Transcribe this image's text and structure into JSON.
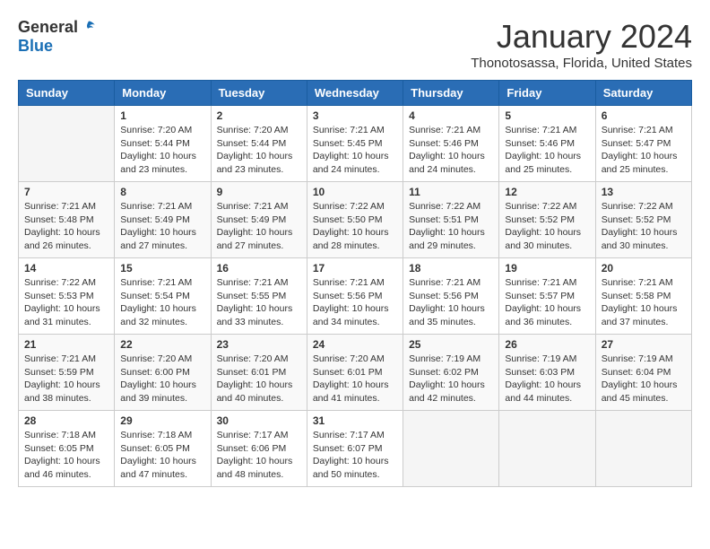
{
  "header": {
    "logo_general": "General",
    "logo_blue": "Blue",
    "title": "January 2024",
    "subtitle": "Thonotosassa, Florida, United States"
  },
  "days_of_week": [
    "Sunday",
    "Monday",
    "Tuesday",
    "Wednesday",
    "Thursday",
    "Friday",
    "Saturday"
  ],
  "weeks": [
    [
      {
        "day": "",
        "info": ""
      },
      {
        "day": "1",
        "info": "Sunrise: 7:20 AM\nSunset: 5:44 PM\nDaylight: 10 hours\nand 23 minutes."
      },
      {
        "day": "2",
        "info": "Sunrise: 7:20 AM\nSunset: 5:44 PM\nDaylight: 10 hours\nand 23 minutes."
      },
      {
        "day": "3",
        "info": "Sunrise: 7:21 AM\nSunset: 5:45 PM\nDaylight: 10 hours\nand 24 minutes."
      },
      {
        "day": "4",
        "info": "Sunrise: 7:21 AM\nSunset: 5:46 PM\nDaylight: 10 hours\nand 24 minutes."
      },
      {
        "day": "5",
        "info": "Sunrise: 7:21 AM\nSunset: 5:46 PM\nDaylight: 10 hours\nand 25 minutes."
      },
      {
        "day": "6",
        "info": "Sunrise: 7:21 AM\nSunset: 5:47 PM\nDaylight: 10 hours\nand 25 minutes."
      }
    ],
    [
      {
        "day": "7",
        "info": "Sunrise: 7:21 AM\nSunset: 5:48 PM\nDaylight: 10 hours\nand 26 minutes."
      },
      {
        "day": "8",
        "info": "Sunrise: 7:21 AM\nSunset: 5:49 PM\nDaylight: 10 hours\nand 27 minutes."
      },
      {
        "day": "9",
        "info": "Sunrise: 7:21 AM\nSunset: 5:49 PM\nDaylight: 10 hours\nand 27 minutes."
      },
      {
        "day": "10",
        "info": "Sunrise: 7:22 AM\nSunset: 5:50 PM\nDaylight: 10 hours\nand 28 minutes."
      },
      {
        "day": "11",
        "info": "Sunrise: 7:22 AM\nSunset: 5:51 PM\nDaylight: 10 hours\nand 29 minutes."
      },
      {
        "day": "12",
        "info": "Sunrise: 7:22 AM\nSunset: 5:52 PM\nDaylight: 10 hours\nand 30 minutes."
      },
      {
        "day": "13",
        "info": "Sunrise: 7:22 AM\nSunset: 5:52 PM\nDaylight: 10 hours\nand 30 minutes."
      }
    ],
    [
      {
        "day": "14",
        "info": "Sunrise: 7:22 AM\nSunset: 5:53 PM\nDaylight: 10 hours\nand 31 minutes."
      },
      {
        "day": "15",
        "info": "Sunrise: 7:21 AM\nSunset: 5:54 PM\nDaylight: 10 hours\nand 32 minutes."
      },
      {
        "day": "16",
        "info": "Sunrise: 7:21 AM\nSunset: 5:55 PM\nDaylight: 10 hours\nand 33 minutes."
      },
      {
        "day": "17",
        "info": "Sunrise: 7:21 AM\nSunset: 5:56 PM\nDaylight: 10 hours\nand 34 minutes."
      },
      {
        "day": "18",
        "info": "Sunrise: 7:21 AM\nSunset: 5:56 PM\nDaylight: 10 hours\nand 35 minutes."
      },
      {
        "day": "19",
        "info": "Sunrise: 7:21 AM\nSunset: 5:57 PM\nDaylight: 10 hours\nand 36 minutes."
      },
      {
        "day": "20",
        "info": "Sunrise: 7:21 AM\nSunset: 5:58 PM\nDaylight: 10 hours\nand 37 minutes."
      }
    ],
    [
      {
        "day": "21",
        "info": "Sunrise: 7:21 AM\nSunset: 5:59 PM\nDaylight: 10 hours\nand 38 minutes."
      },
      {
        "day": "22",
        "info": "Sunrise: 7:20 AM\nSunset: 6:00 PM\nDaylight: 10 hours\nand 39 minutes."
      },
      {
        "day": "23",
        "info": "Sunrise: 7:20 AM\nSunset: 6:01 PM\nDaylight: 10 hours\nand 40 minutes."
      },
      {
        "day": "24",
        "info": "Sunrise: 7:20 AM\nSunset: 6:01 PM\nDaylight: 10 hours\nand 41 minutes."
      },
      {
        "day": "25",
        "info": "Sunrise: 7:19 AM\nSunset: 6:02 PM\nDaylight: 10 hours\nand 42 minutes."
      },
      {
        "day": "26",
        "info": "Sunrise: 7:19 AM\nSunset: 6:03 PM\nDaylight: 10 hours\nand 44 minutes."
      },
      {
        "day": "27",
        "info": "Sunrise: 7:19 AM\nSunset: 6:04 PM\nDaylight: 10 hours\nand 45 minutes."
      }
    ],
    [
      {
        "day": "28",
        "info": "Sunrise: 7:18 AM\nSunset: 6:05 PM\nDaylight: 10 hours\nand 46 minutes."
      },
      {
        "day": "29",
        "info": "Sunrise: 7:18 AM\nSunset: 6:05 PM\nDaylight: 10 hours\nand 47 minutes."
      },
      {
        "day": "30",
        "info": "Sunrise: 7:17 AM\nSunset: 6:06 PM\nDaylight: 10 hours\nand 48 minutes."
      },
      {
        "day": "31",
        "info": "Sunrise: 7:17 AM\nSunset: 6:07 PM\nDaylight: 10 hours\nand 50 minutes."
      },
      {
        "day": "",
        "info": ""
      },
      {
        "day": "",
        "info": ""
      },
      {
        "day": "",
        "info": ""
      }
    ]
  ]
}
